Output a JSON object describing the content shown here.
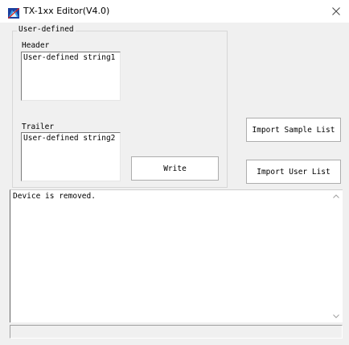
{
  "window": {
    "title": "TX-1xx Editor(V4.0)",
    "app_icon": "tx-editor-logo-icon",
    "close_icon": "close-icon"
  },
  "user_defined": {
    "group_label": "User-defined",
    "header_label": "Header",
    "header_value": "User-defined string1",
    "trailer_label": "Trailer",
    "trailer_value": "User-defined string2",
    "write_label": "Write"
  },
  "actions": {
    "import_sample_label": "Import Sample List",
    "import_user_label": "Import User List"
  },
  "log": {
    "text": "Device is removed.",
    "scroll_up_icon": "chevron-up-icon",
    "scroll_down_icon": "chevron-down-icon"
  },
  "status_bar": {
    "text": ""
  }
}
